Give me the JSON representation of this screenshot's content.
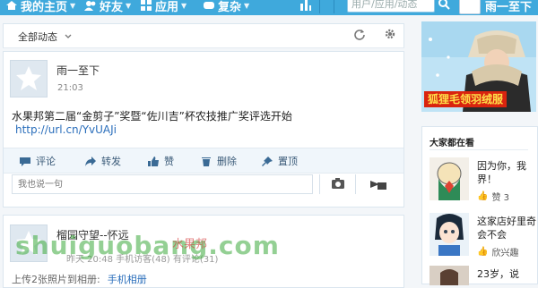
{
  "topnav": {
    "home": "我的主页",
    "friends": "好友",
    "apps": "应用",
    "games": "复杂",
    "search_placeholder": "用户/应用/动态",
    "username": "雨一至下"
  },
  "feed": {
    "filter_label": "全部动态"
  },
  "post1": {
    "author": "雨一至下",
    "time": "21:03",
    "text": "水果邦第二届“金剪子”奖暨“佐川吉”杯农技推广奖评选开始",
    "link": "http://url.cn/YvUAJi",
    "actions": [
      "评论",
      "转发",
      "赞",
      "删除",
      "置顶"
    ],
    "reply_placeholder": "我也说一句"
  },
  "post2": {
    "author": "榴园守望--怀远",
    "meta": "昨天 20:48 手机访客(48)  有评论(31)",
    "subtext": "上传2张照片到相册:",
    "sublink": "手机相册"
  },
  "ad": {
    "banner": "狐狸毛领羽绒服"
  },
  "sidebar": {
    "title": "大家都在看",
    "items": [
      {
        "text": "因为你，我界！",
        "likes": "赞 3"
      },
      {
        "text": "这家店好里奇会不会",
        "likes": "欣兴趣"
      },
      {
        "text": "23岁，说",
        "likes": ""
      }
    ]
  },
  "watermark": {
    "domain": "shuiguobang.com",
    "cn": "水果邦"
  },
  "colors": {
    "topbar": "#3fa9dc",
    "link": "#2a6ebb",
    "ad_red": "#d9240f"
  }
}
